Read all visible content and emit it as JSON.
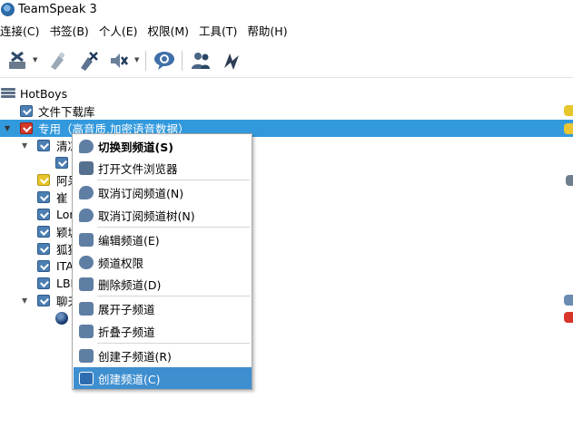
{
  "window": {
    "title": "TeamSpeak 3"
  },
  "menubar": {
    "items": [
      {
        "label": "连接(C)"
      },
      {
        "label": "书签(B)"
      },
      {
        "label": "个人(E)"
      },
      {
        "label": "权限(M)"
      },
      {
        "label": "工具(T)"
      },
      {
        "label": "帮助(H)"
      }
    ]
  },
  "toolbar": {
    "buttons": [
      {
        "icon": "disconnect-icon",
        "has_dropdown": true
      },
      {
        "icon": "away-icon",
        "has_dropdown": false
      },
      {
        "icon": "mute-microphone-icon",
        "has_dropdown": false
      },
      {
        "icon": "mute-speakers-icon",
        "has_dropdown": true
      },
      {
        "icon": "chat-icon",
        "has_dropdown": false
      },
      {
        "icon": "contacts-icon",
        "has_dropdown": false
      },
      {
        "icon": "identity-icon",
        "has_dropdown": false
      }
    ]
  },
  "tree": {
    "server": {
      "label": "HotBoys"
    },
    "rows": [
      {
        "label": "文件下载库",
        "icon": "channel-icon",
        "color": "blue"
      },
      {
        "label": "专用（高音质,加密语音数据）",
        "icon": "channel-icon",
        "color": "red",
        "selected": true,
        "expanded": true
      },
      {
        "label": "清凉",
        "icon": "channel-icon",
        "color": "blue",
        "expanded": true
      },
      {
        "label": "",
        "icon": "channel-icon",
        "color": "blue"
      },
      {
        "label": "阿呆",
        "icon": "channel-icon",
        "color": "yellow"
      },
      {
        "label": "崔",
        "icon": "channel-icon",
        "color": "blue"
      },
      {
        "label": "Lon",
        "icon": "channel-icon",
        "color": "blue"
      },
      {
        "label": "颖城",
        "icon": "channel-icon",
        "color": "blue"
      },
      {
        "label": "狐狸",
        "icon": "channel-icon",
        "color": "blue"
      },
      {
        "label": "ITA",
        "icon": "channel-icon",
        "color": "blue"
      },
      {
        "label": "LBL",
        "icon": "channel-icon",
        "color": "blue"
      },
      {
        "label": "聊天",
        "icon": "channel-icon",
        "color": "blue",
        "expanded": true
      },
      {
        "label": "",
        "icon": "user-icon",
        "color": "navy"
      }
    ]
  },
  "context_menu": {
    "items": [
      {
        "label": "切换到频道(S)",
        "icon": "switch-channel-icon",
        "bold": true
      },
      {
        "label": "打开文件浏览器",
        "icon": "file-browser-icon"
      },
      {
        "label": "取消订阅频道(N)",
        "icon": "unsubscribe-icon"
      },
      {
        "label": "取消订阅频道树(N)",
        "icon": "unsubscribe-tree-icon"
      },
      {
        "label": "编辑频道(E)",
        "icon": "edit-channel-icon"
      },
      {
        "label": "频道权限",
        "icon": "channel-permissions-icon"
      },
      {
        "label": "删除频道(D)",
        "icon": "delete-channel-icon"
      },
      {
        "label": "展开子频道",
        "icon": "expand-subchannels-icon"
      },
      {
        "label": "折叠子频道",
        "icon": "collapse-subchannels-icon"
      },
      {
        "label": "创建子频道(R)",
        "icon": "create-subchannel-icon"
      },
      {
        "label": "创建频道(C)",
        "icon": "create-channel-icon",
        "highlighted": true
      }
    ]
  },
  "colors": {
    "selection": "#3399dd",
    "menu_highlight": "#3e8fd0",
    "channel_blue": "#4d7fb3",
    "channel_red": "#d33a2c",
    "channel_yellow": "#e7c62c"
  }
}
